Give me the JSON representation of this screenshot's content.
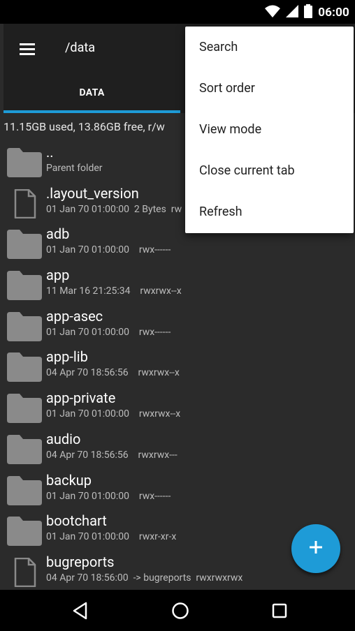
{
  "status_bar": {
    "time": "06:00",
    "icons": [
      "wifi-icon",
      "signal-icon",
      "battery-icon"
    ]
  },
  "app_bar": {
    "menu_icon": "hamburger-menu-icon",
    "path": "/data"
  },
  "tabs": [
    {
      "label": "DATA",
      "active": true
    }
  ],
  "storage_info": "11.15GB used, 13.86GB free, r/w",
  "files": [
    {
      "name": "..",
      "meta": "Parent folder",
      "type": "folder"
    },
    {
      "name": ".layout_version",
      "meta": "01 Jan 70 01:00:00  2 Bytes  rw",
      "type": "file"
    },
    {
      "name": "adb",
      "meta": "01 Jan 70 01:00:00    rwx------",
      "type": "folder"
    },
    {
      "name": "app",
      "meta": "11 Mar 16 21:25:34    rwxrwx--x",
      "type": "folder"
    },
    {
      "name": "app-asec",
      "meta": "01 Jan 70 01:00:00    rwx------",
      "type": "folder"
    },
    {
      "name": "app-lib",
      "meta": "04 Apr 70 18:56:56    rwxrwx--x",
      "type": "folder"
    },
    {
      "name": "app-private",
      "meta": "01 Jan 70 01:00:00    rwxrwx--x",
      "type": "folder"
    },
    {
      "name": "audio",
      "meta": "04 Apr 70 18:56:56    rwxrwx---",
      "type": "folder"
    },
    {
      "name": "backup",
      "meta": "01 Jan 70 01:00:00    rwx------",
      "type": "folder"
    },
    {
      "name": "bootchart",
      "meta": "01 Jan 70 01:00:00    rwxr-xr-x",
      "type": "folder"
    },
    {
      "name": "bugreports",
      "meta": "04 Apr 70 18:56:00  -> bugreports  rwxrwxrwx",
      "type": "file"
    }
  ],
  "overflow_menu": [
    "Search",
    "Sort order",
    "View mode",
    "Close current tab",
    "Refresh"
  ],
  "fab": {
    "icon": "plus-icon"
  },
  "nav_bar": {
    "buttons": [
      "back-icon",
      "home-icon",
      "recents-icon"
    ]
  },
  "colors": {
    "accent": "#1e9bd7",
    "background": "#2b2b2b",
    "bar": "#1f1f1f",
    "folder": "#8a8a8a"
  }
}
